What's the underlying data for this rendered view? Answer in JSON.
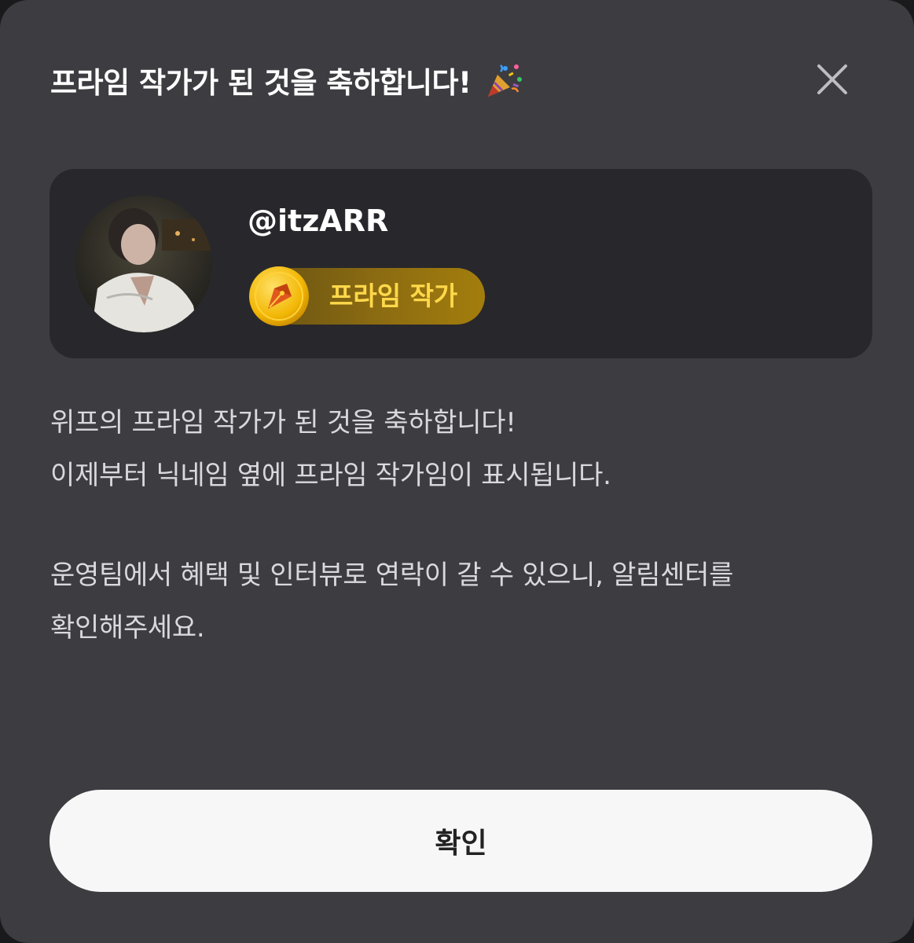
{
  "dialog": {
    "title": "프라임 작가가 된 것을 축하합니다!",
    "title_emoji_icon": "party-popper-icon",
    "close_icon": "close-icon"
  },
  "profile": {
    "username": "@itzARR",
    "badge": {
      "icon": "pen-nib-coin-icon",
      "label": "프라임 작가"
    }
  },
  "message": {
    "line1": "위프의 프라임 작가가 된 것을 축하합니다!",
    "line2": "이제부터 닉네임 옆에 프라임 작가임이 표시됩니다.",
    "line3": "운영팀에서 혜택 및 인터뷰로 연락이 갈 수 있으니, 알림센터를",
    "line4": "확인해주세요."
  },
  "actions": {
    "confirm_label": "확인"
  },
  "colors": {
    "modal_bg": "#3d3c41",
    "card_bg": "#28272c",
    "badge_text": "#ffd84a",
    "button_bg": "#f7f7f7"
  }
}
